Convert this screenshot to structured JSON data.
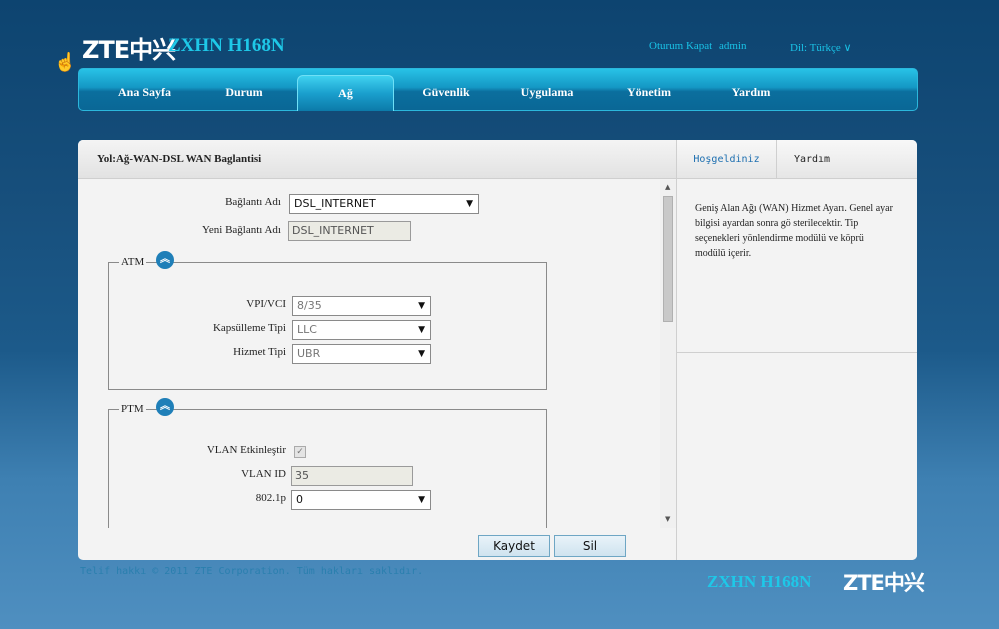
{
  "header": {
    "logo": "ZTE中兴",
    "model": "ZXHN H168N",
    "logout": "Oturum Kapat",
    "user": "admin",
    "language": "Dil: Türkçe ∨"
  },
  "nav": {
    "items": [
      "Ana Sayfa",
      "Durum",
      "Ağ",
      "Güvenlik",
      "Uygulama",
      "Yönetim",
      "Yardım"
    ],
    "active": "Ağ"
  },
  "page": {
    "path": "Yol:Ağ-WAN-DSL WAN Baglantisi"
  },
  "form": {
    "connection_name_label": "Bağlantı Adı",
    "connection_name_value": "DSL_INTERNET",
    "new_connection_name_label": "Yeni Bağlantı Adı",
    "new_connection_name_value": "DSL_INTERNET",
    "atm": {
      "legend": "ATM",
      "vpi_vci_label": "VPI/VCI",
      "vpi_vci_value": "8/35",
      "encap_label": "Kapsülleme Tipi",
      "encap_value": "LLC",
      "service_label": "Hizmet Tipi",
      "service_value": "UBR"
    },
    "ptm": {
      "legend": "PTM",
      "vlan_enable_label": "VLAN Etkinleştir",
      "vlan_enable_checked": true,
      "vlan_id_label": "VLAN ID",
      "vlan_id_value": "35",
      "dot1p_label": "802.1p",
      "dot1p_value": "0"
    },
    "save_button": "Kaydet",
    "delete_button": "Sil"
  },
  "help": {
    "tab_welcome": "Hoşgeldiniz",
    "tab_help": "Yardım",
    "text": "Geniş Alan Ağı (WAN) Hizmet Ayarı. Genel ayar bilgisi ayardan sonra gö sterilecektir. Tip seçenekleri yönlendirme modülü ve köprü modülü içerir."
  },
  "footer": {
    "copyright": "Telif hakkı © 2011 ZTE Corporation. Tüm hakları saklıdır.",
    "model": "ZXHN H168N",
    "logo": "ZTE中兴"
  },
  "icons": {
    "dropdown_arrow": "▼",
    "collapse": "︽",
    "scroll_up": "▲",
    "scroll_down": "▼"
  },
  "colors": {
    "accent_cyan": "#1ec8e8",
    "nav_blue": "#1497c4",
    "background_top": "#0d4470"
  }
}
